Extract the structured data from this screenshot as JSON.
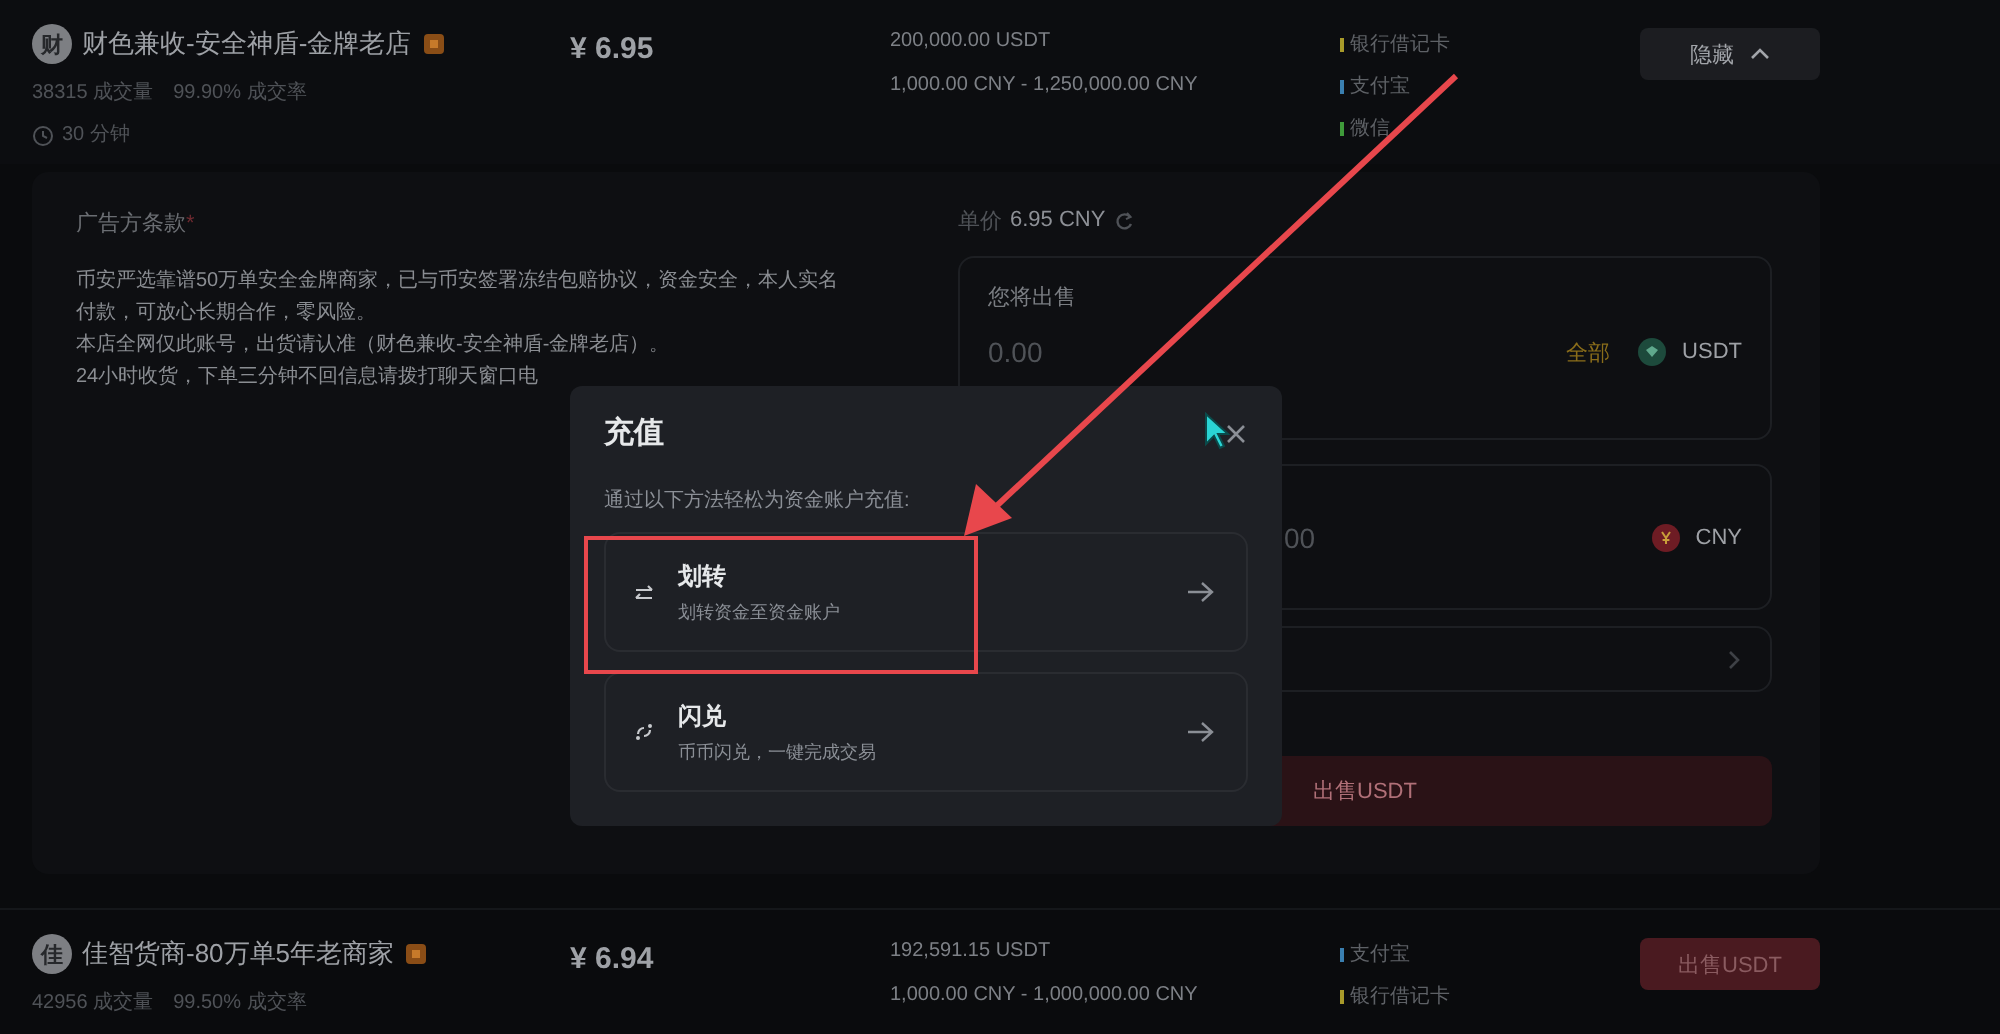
{
  "ads": [
    {
      "avatar_letter": "财",
      "merchant": "财色兼收-安全神盾-金牌老店",
      "orders": "38315 成交量",
      "completion": "99.90% 成交率",
      "time": "30 分钟",
      "price": "¥ 6.95",
      "available": "200,000.00 USDT",
      "limit": "1,000.00 CNY - 1,250,000.00 CNY",
      "payments": [
        {
          "name": "银行借记卡",
          "color": "#a89a2a"
        },
        {
          "name": "支付宝",
          "color": "#3a7fb0"
        },
        {
          "name": "微信",
          "color": "#3f9a3a"
        }
      ],
      "action": {
        "kind": "collapse",
        "label": "隐藏"
      },
      "expanded": true
    },
    {
      "avatar_letter": "佳",
      "merchant": "佳智货商-80万单5年老商家",
      "orders": "42956 成交量",
      "completion": "99.50% 成交率",
      "price": "¥ 6.94",
      "available": "192,591.15 USDT",
      "limit": "1,000.00 CNY - 1,000,000.00 CNY",
      "payments": [
        {
          "name": "支付宝",
          "color": "#3a7fb0"
        },
        {
          "name": "银行借记卡",
          "color": "#a89a2a"
        }
      ],
      "action": {
        "kind": "sell",
        "label": "出售USDT"
      },
      "expanded": false
    }
  ],
  "detail": {
    "terms_title": "广告方条款",
    "required_mark": "*",
    "terms": [
      "币安严选靠谱50万单安全金牌商家，已与币安签署冻结包赔协议，资金安全，本人实名付款，可放心长期合作，零风险。",
      "本店全网仅此账号，出货请认准（财色兼收-安全神盾-金牌老店）。",
      "24小时收货，下单三分钟不回信息请拨打聊天窗口电"
    ],
    "unit_price_label": "单价",
    "unit_price": "6.95 CNY",
    "sell_label": "您将出售",
    "sell_placeholder": "0.00",
    "max_label": "全部",
    "sell_currency": "USDT",
    "receive_value": "00",
    "receive_currency": "CNY",
    "submit": "出售USDT"
  },
  "modal": {
    "title": "充值",
    "subtitle": "通过以下方法轻松为资金账户充值:",
    "options": [
      {
        "kind": "transfer",
        "title": "划转",
        "description": "划转资金至资金账户",
        "highlighted": true
      },
      {
        "kind": "convert",
        "title": "闪兑",
        "description": "币币闪兑，一键完成交易",
        "highlighted": false
      }
    ]
  }
}
